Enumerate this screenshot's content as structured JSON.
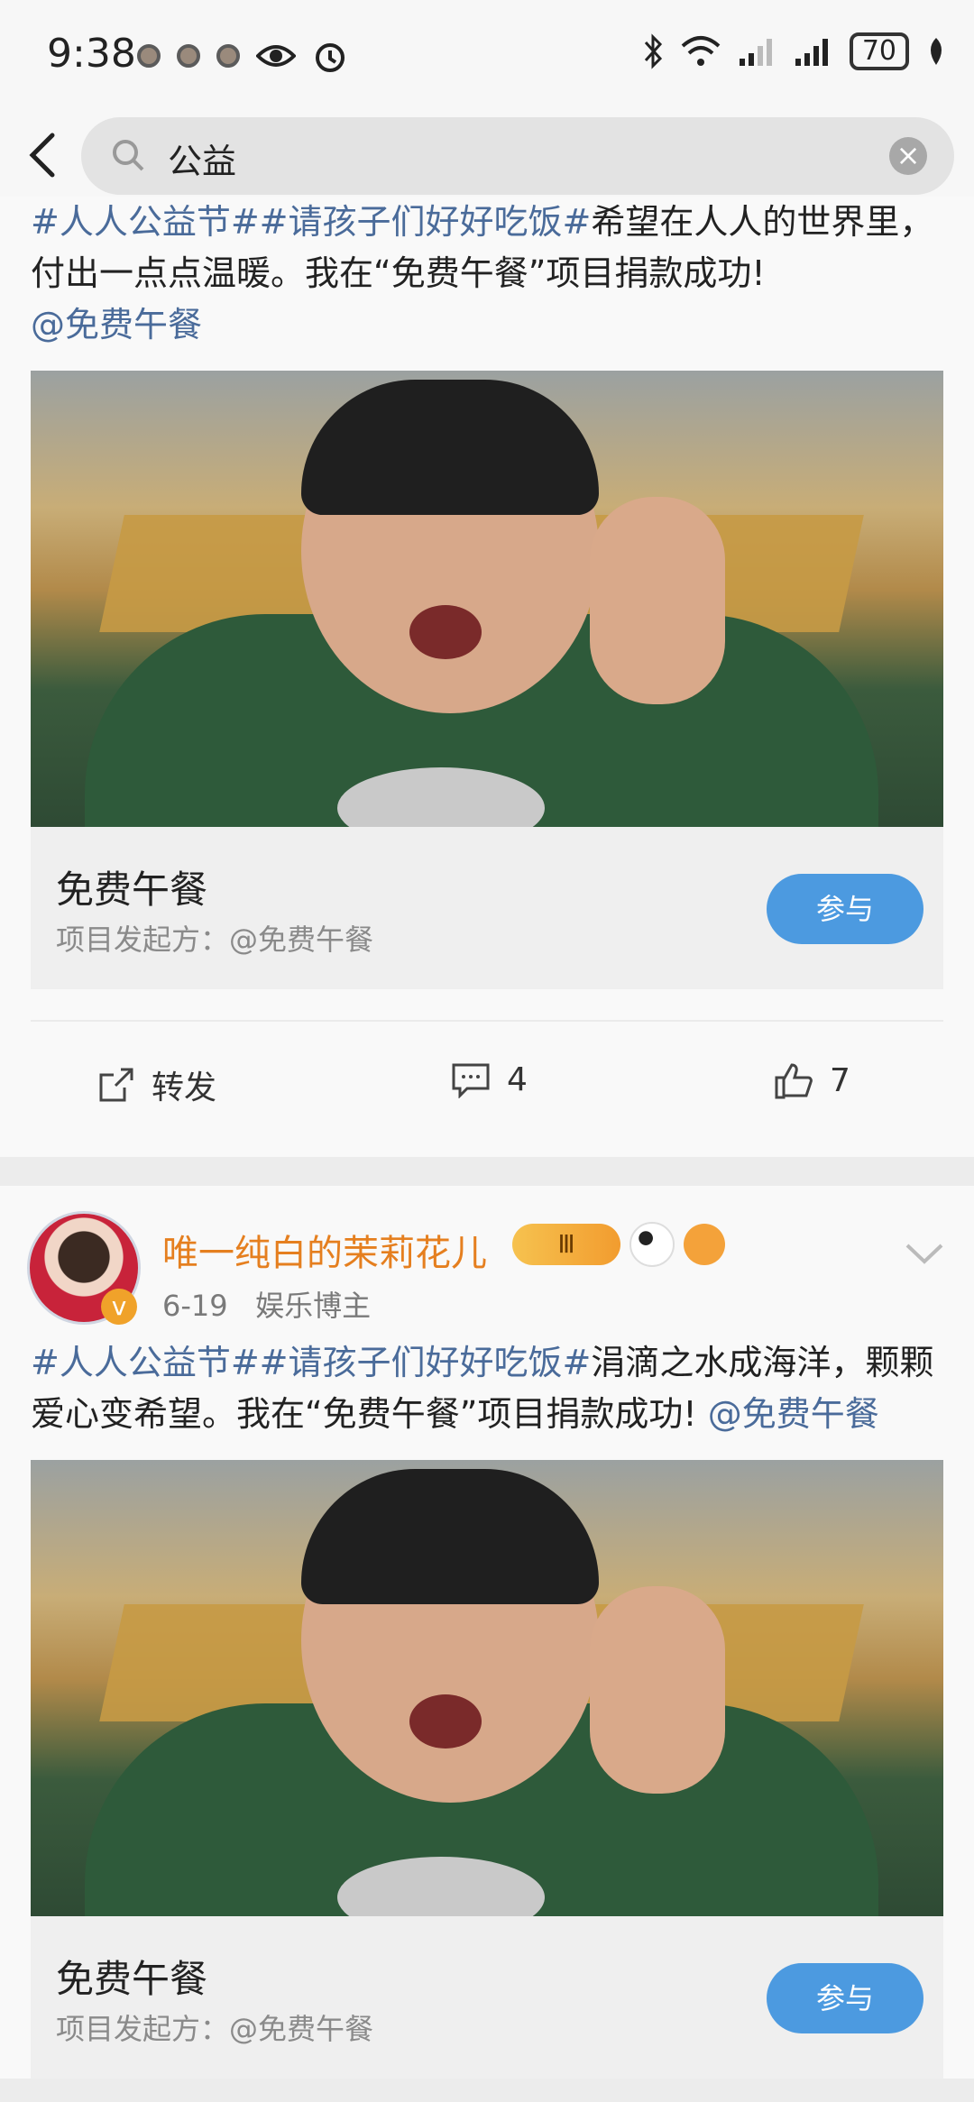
{
  "status_bar": {
    "time": "9:38",
    "battery": "70"
  },
  "search": {
    "query": "公益"
  },
  "post1": {
    "text_tags": "#人人公益节##请孩子们好好吃饭#",
    "text_body": "希望在人人的世界里，付出一点点温暖。我在“免费午餐”项目捐款成功!",
    "mention": "@免费午餐",
    "project": {
      "title": "免费午餐",
      "sponsor": "项目发起方：@免费午餐",
      "join_label": "参与"
    },
    "actions": {
      "repost_label": "转发",
      "comment_count": "4",
      "like_count": "7"
    }
  },
  "post2": {
    "username": "唯一纯白的茉莉花儿",
    "level_badge": "Ⅲ",
    "date": "6-19",
    "role": "娱乐博主",
    "text_tags": "#人人公益节##请孩子们好好吃饭#",
    "text_body": "涓滴之水成海洋，颗颗爱心变希望。我在“免费午餐”项目捐款成功! ",
    "mention": "@免费午餐",
    "project": {
      "title": "免费午餐",
      "sponsor": "项目发起方：@免费午餐",
      "join_label": "参与"
    }
  },
  "colors": {
    "accent": "#4c9ae0",
    "username": "#e57f1f",
    "tag": "#4a6b9a"
  }
}
